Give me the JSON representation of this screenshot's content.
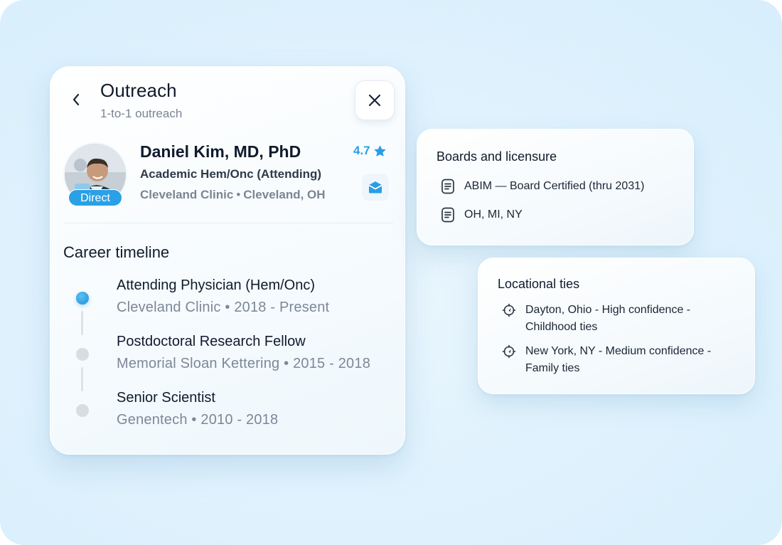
{
  "header": {
    "title": "Outreach",
    "subtitle": "1-to-1 outreach"
  },
  "profile": {
    "name": "Daniel Kim, MD, PhD",
    "role": "Academic Hem/Onc (Attending)",
    "organization": "Cleveland Clinic",
    "location_separator": "•",
    "city": "Cleveland, OH",
    "rating": "4.7",
    "badge": "Direct"
  },
  "career": {
    "title": "Career timeline",
    "items": [
      {
        "title": "Attending Physician (Hem/Onc)",
        "subtitle": "Cleveland Clinic • 2018 - Present",
        "active": true
      },
      {
        "title": "Postdoctoral Research Fellow",
        "subtitle": "Memorial Sloan Kettering • 2015 - 2018",
        "active": false
      },
      {
        "title": "Senior Scientist",
        "subtitle": "Genentech • 2010 - 2018",
        "active": false
      }
    ]
  },
  "boards": {
    "title": "Boards and licensure",
    "items": [
      {
        "text": "ABIM — Board Certified (thru 2031)",
        "icon": "document-icon"
      },
      {
        "text": "OH, MI, NY",
        "icon": "document-icon"
      }
    ]
  },
  "ties": {
    "title": "Locational ties",
    "items": [
      {
        "text": "Dayton, Ohio - High confidence - Childhood ties",
        "icon": "location-target-icon"
      },
      {
        "text": "New York, NY - Medium confidence - Family ties",
        "icon": "location-target-icon"
      }
    ]
  },
  "colors": {
    "accent": "#2a9ee4",
    "text_primary": "#0f1b2d",
    "text_muted": "#7d8796",
    "background": "#e0f2fd"
  }
}
